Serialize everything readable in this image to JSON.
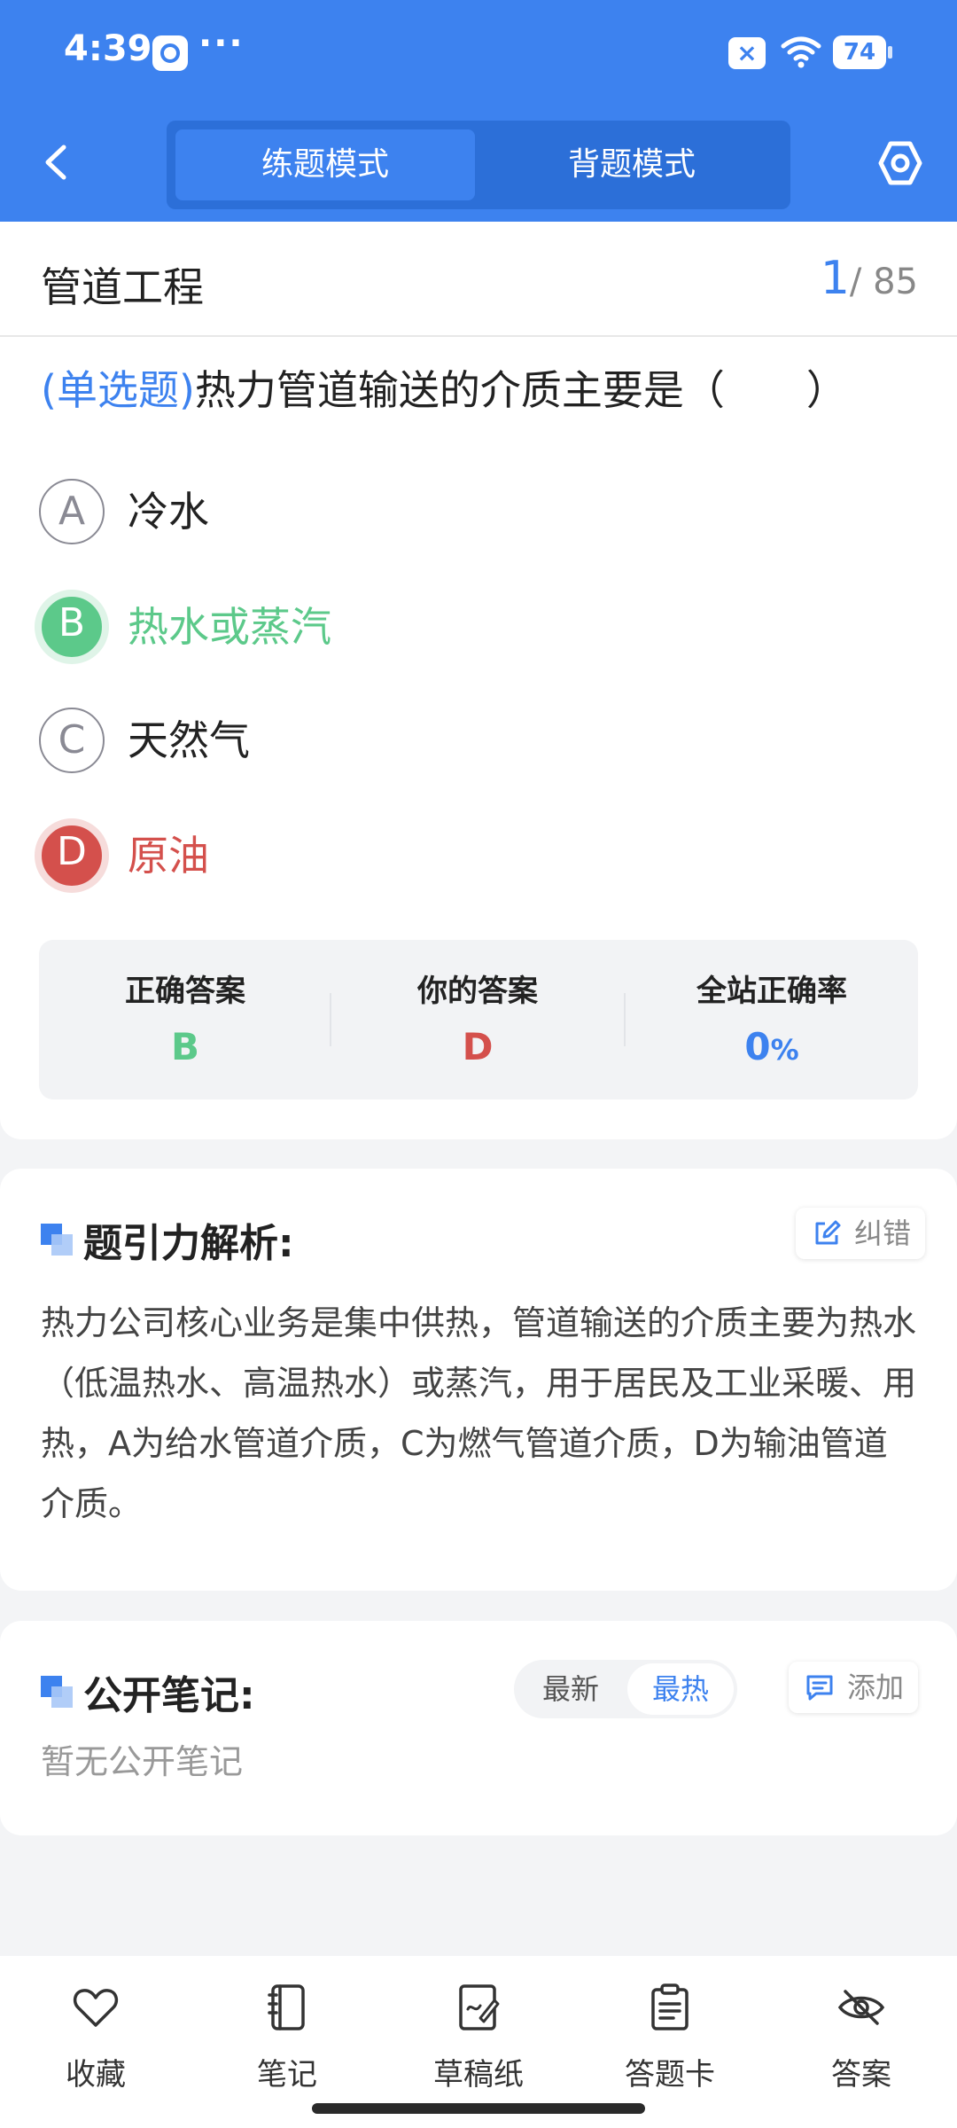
{
  "status_bar": {
    "time": "4:39",
    "dots": "···",
    "battery": "74"
  },
  "header": {
    "mode_tabs": [
      "练题模式",
      "背题模式"
    ],
    "active_tab": "练题模式",
    "accent_color": "#3d82ef"
  },
  "question_card": {
    "subject": "管道工程",
    "current": "1",
    "total": "/ 85",
    "type_label": "(单选题)",
    "question_text": "热力管道输送的介质主要是（　　）",
    "options": [
      {
        "letter": "A",
        "text": "冷水",
        "state": "normal"
      },
      {
        "letter": "B",
        "text": "热水或蒸汽",
        "state": "correct"
      },
      {
        "letter": "C",
        "text": "天然气",
        "state": "normal"
      },
      {
        "letter": "D",
        "text": "原油",
        "state": "wrong"
      }
    ],
    "stats": {
      "correct_label": "正确答案",
      "correct_value": "B",
      "yours_label": "你的答案",
      "yours_value": "D",
      "rate_label": "全站正确率",
      "rate_value": "0",
      "rate_unit": "%"
    }
  },
  "analysis": {
    "title": "题引力解析:",
    "correct_button": "纠错",
    "text": "热力公司核心业务是集中供热，管道输送的介质主要为热水（低温热水、高温热水）或蒸汽，用于居民及工业采暖、用热，A为给水管道介质，C为燃气管道介质，D为输油管道介质。"
  },
  "notes": {
    "title": "公开笔记:",
    "sort_options": [
      "最新",
      "最热"
    ],
    "active_sort": "最热",
    "add_button": "添加",
    "empty_text": "暂无公开笔记"
  },
  "tabbar": {
    "items": [
      "收藏",
      "笔记",
      "草稿纸",
      "答题卡",
      "答案"
    ]
  },
  "colors": {
    "correct": "#5cc98a",
    "wrong": "#d4504c",
    "primary": "#3d82ef"
  }
}
